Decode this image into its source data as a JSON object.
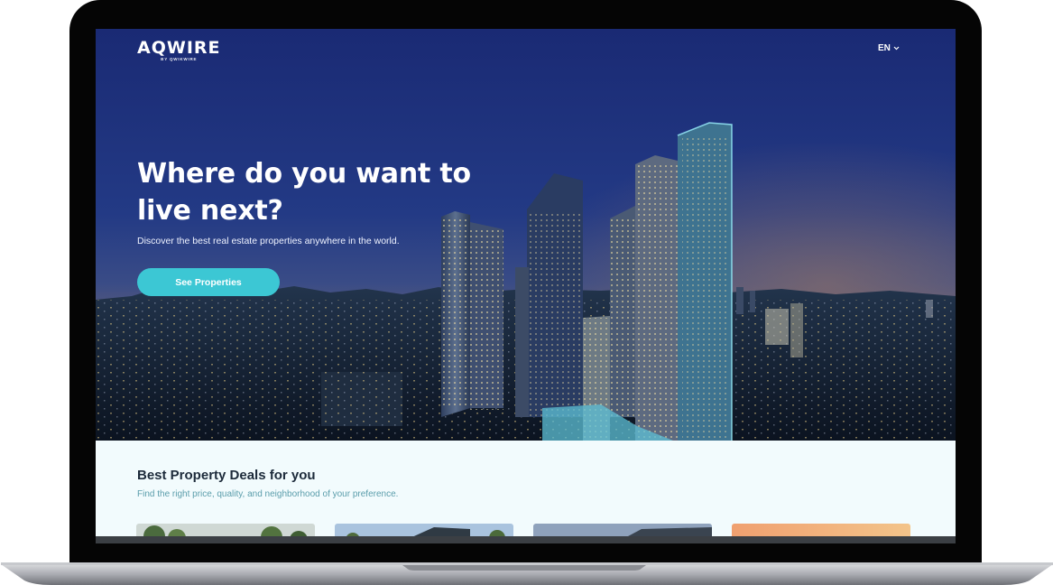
{
  "brand": {
    "name": "AQWIRE",
    "tagline": "BY QWIKWIRE"
  },
  "language": {
    "selected": "EN"
  },
  "hero": {
    "headline": "Where do you want to live next?",
    "subtitle": "Discover the best real estate properties anywhere in the world.",
    "cta_label": "See Properties"
  },
  "deals": {
    "title": "Best Property Deals for you",
    "subtitle": "Find the right price, quality, and neighborhood of your preference."
  },
  "colors": {
    "accent": "#3cc7d4",
    "hero_sky": "#1a2a6c",
    "section_bg": "#f2fbfd"
  }
}
